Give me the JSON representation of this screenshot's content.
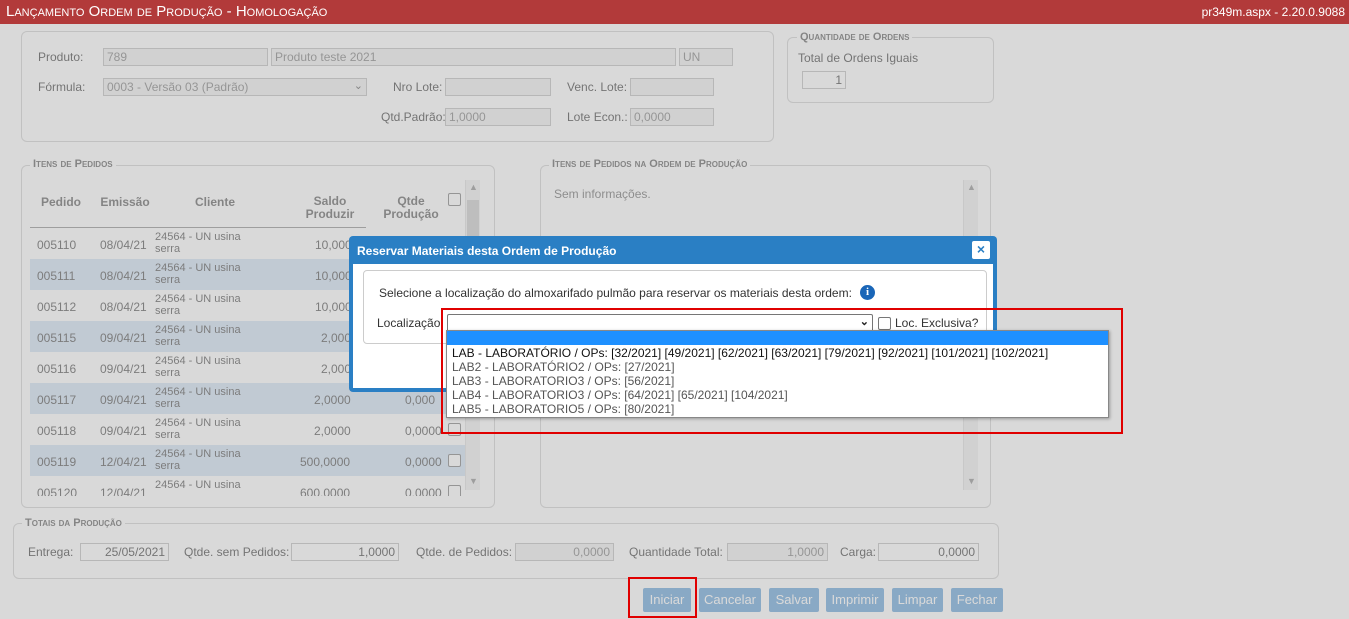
{
  "title_bar": {
    "title": "Lançamento Ordem de Produção  - Homologação",
    "version": "pr349m.aspx - 2.20.0.9088"
  },
  "product": {
    "produto_label": "Produto:",
    "produto_code": "789",
    "produto_name": "Produto teste 2021",
    "produto_unit": "UN",
    "formula_label": "Fórmula:",
    "formula_value": "0003 - Versão 03 (Padrão)",
    "nro_lote_label": "Nro Lote:",
    "nro_lote_value": "",
    "venc_lote_label": "Venc. Lote:",
    "venc_lote_value": "",
    "qtd_padrao_label": "Qtd.Padrão:",
    "qtd_padrao_value": "1,0000",
    "lote_econ_label": "Lote Econ.:",
    "lote_econ_value": "0,0000"
  },
  "orders_qty": {
    "legend": "Quantidade de Ordens",
    "label": "Total de Ordens Iguais",
    "value": "1"
  },
  "items": {
    "legend": "Itens de Pedidos",
    "columns": [
      "Pedido",
      "Emissão",
      "Cliente",
      "Saldo Produzir",
      "Qtde Produção"
    ],
    "rows": [
      {
        "pedido": "005110",
        "emissao": "08/04/21",
        "cliente": "24564 - UN usina serra",
        "saldo": "10,000",
        "qtde": ""
      },
      {
        "pedido": "005111",
        "emissao": "08/04/21",
        "cliente": "24564 - UN usina serra",
        "saldo": "10,000",
        "qtde": ""
      },
      {
        "pedido": "005112",
        "emissao": "08/04/21",
        "cliente": "24564 - UN usina serra",
        "saldo": "10,000",
        "qtde": ""
      },
      {
        "pedido": "005115",
        "emissao": "09/04/21",
        "cliente": "24564 - UN usina serra",
        "saldo": "2,000",
        "qtde": ""
      },
      {
        "pedido": "005116",
        "emissao": "09/04/21",
        "cliente": "24564 - UN usina serra",
        "saldo": "2,000",
        "qtde": ""
      },
      {
        "pedido": "005117",
        "emissao": "09/04/21",
        "cliente": "24564 - UN usina serra",
        "saldo": "2,0000",
        "qtde": "0,000"
      },
      {
        "pedido": "005118",
        "emissao": "09/04/21",
        "cliente": "24564 - UN usina serra",
        "saldo": "2,0000",
        "qtde": "0,0000"
      },
      {
        "pedido": "005119",
        "emissao": "12/04/21",
        "cliente": "24564 - UN usina serra",
        "saldo": "500,0000",
        "qtde": "0,0000"
      },
      {
        "pedido": "005120",
        "emissao": "12/04/21",
        "cliente": "24564 - UN usina",
        "saldo": "600,0000",
        "qtde": "0,0000"
      }
    ]
  },
  "items_in_order": {
    "legend": "Itens de Pedidos na Ordem de Produção",
    "empty_text": "Sem informações."
  },
  "totals": {
    "legend": "Totais da Produção",
    "entrega_label": "Entrega:",
    "entrega_value": "25/05/2021",
    "sem_pedidos_label": "Qtde. sem Pedidos:",
    "sem_pedidos_value": "1,0000",
    "de_pedidos_label": "Qtde. de Pedidos:",
    "de_pedidos_value": "0,0000",
    "total_label": "Quantidade Total:",
    "total_value": "1,0000",
    "carga_label": "Carga:",
    "carga_value": "0,0000"
  },
  "buttons": {
    "iniciar": "Iniciar",
    "cancelar": "Cancelar",
    "salvar": "Salvar",
    "imprimir": "Imprimir",
    "limpar": "Limpar",
    "fechar": "Fechar"
  },
  "dialog": {
    "title": "Reservar Materiais desta Ordem de Produção",
    "close": "×",
    "instruction": "Selecione a localização do almoxarifado pulmão para reservar os materiais desta ordem:",
    "info_icon": "i",
    "localizacao_label": "Localização:",
    "localizacao_value": "",
    "exclusive_label": "Loc. Exclusiva?",
    "options": [
      "",
      "LAB - LABORATÓRIO / OPs: [32/2021] [49/2021] [62/2021] [63/2021] [79/2021] [92/2021] [101/2021] [102/2021]",
      "LAB2 - LABORATÓRIO2 / OPs: [27/2021]",
      "LAB3 - LABORATORIO3 / OPs: [56/2021]",
      "LAB4 - LABORATORIO3 / OPs: [64/2021] [65/2021] [104/2021]",
      "LAB5 - LABORATORIO5 / OPs: [80/2021]"
    ]
  },
  "colors": {
    "title_bar": "#b23a3a",
    "dialog": "#2a7fc4",
    "button": "#5f9fd6",
    "highlight": "#1e90ff",
    "annotation": "#e00000",
    "row_alt": "#cfe0f3"
  }
}
